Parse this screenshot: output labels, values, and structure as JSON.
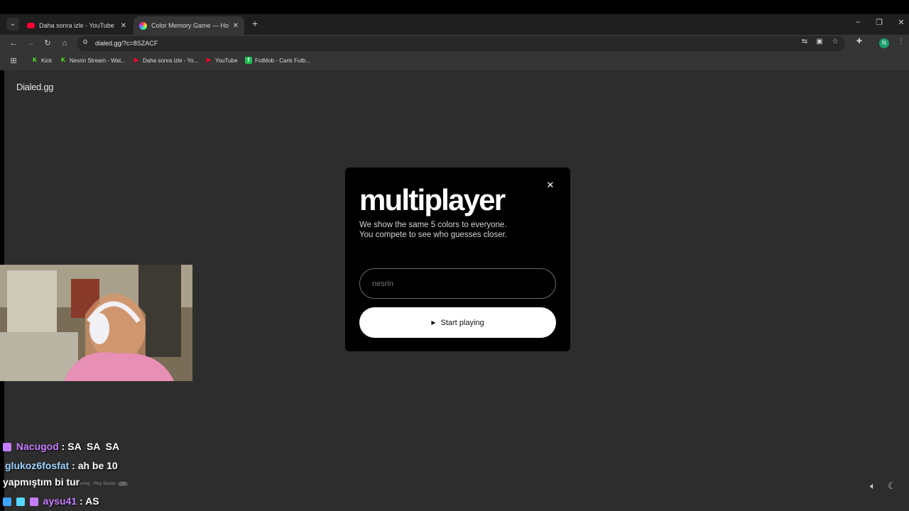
{
  "browser": {
    "tabs": [
      {
        "title": "Daha sonra izle - YouTube",
        "active": false,
        "favicon_color": "#ff0033"
      },
      {
        "title": "Color Memory Game — How W",
        "active": true,
        "favicon_color": "#4aa3ff"
      }
    ],
    "address": {
      "url": "dialed.gg/?c=8SZACF"
    },
    "bookmarks": [
      {
        "label": "Kick",
        "icon_color": "#53fc18"
      },
      {
        "label": "Nesrin Stream - Wat...",
        "icon_color": "#53fc18"
      },
      {
        "label": "Daha sonra izle - Yo...",
        "icon_color": "#ff0033"
      },
      {
        "label": "YouTube",
        "icon_color": "#ff0033"
      },
      {
        "label": "FotMob - Canlı Futb...",
        "icon_color": "#1fbf57"
      }
    ],
    "profile_initial": "N",
    "icons": {
      "apps": "apps-grid-icon",
      "translate": "translate-icon",
      "install": "install-app-icon",
      "bookmark": "star-icon",
      "extensions": "puzzle-icon",
      "menu": "kebab-menu-icon"
    }
  },
  "page": {
    "brand": "Dialed.gg",
    "modal": {
      "title": "multiplayer",
      "description_line1": "We show the same 5 colors to everyone.",
      "description_line2": "You compete to see who guesses closer.",
      "name_value": "nesrin",
      "start_label": "Start playing"
    },
    "footer": {
      "item1": "Scoring",
      "item2": "Play Sound",
      "badge": "Off"
    }
  },
  "overlay": {
    "chat": [
      {
        "user": "Nacugod",
        "sep": ":",
        "message": "SA  SA  SA",
        "user_color": "#c77dff"
      },
      {
        "user": "glukoz6fosfat",
        "sep": ":",
        "message": "ah be 10",
        "user_color": "#9fd3ff"
      },
      {
        "user": "",
        "sep": "",
        "message": "yapmıştım bi tur",
        "user_color": "#ffffff"
      },
      {
        "user": "aysu41",
        "sep": ":",
        "message": "AS",
        "user_color": "#c77dff"
      }
    ]
  },
  "colors": {
    "page_bg": "#2d2d2d",
    "modal_bg": "#000000",
    "button_bg": "#ffffff",
    "tab_active": "#353535",
    "tabstrip": "#1f1f1f"
  }
}
